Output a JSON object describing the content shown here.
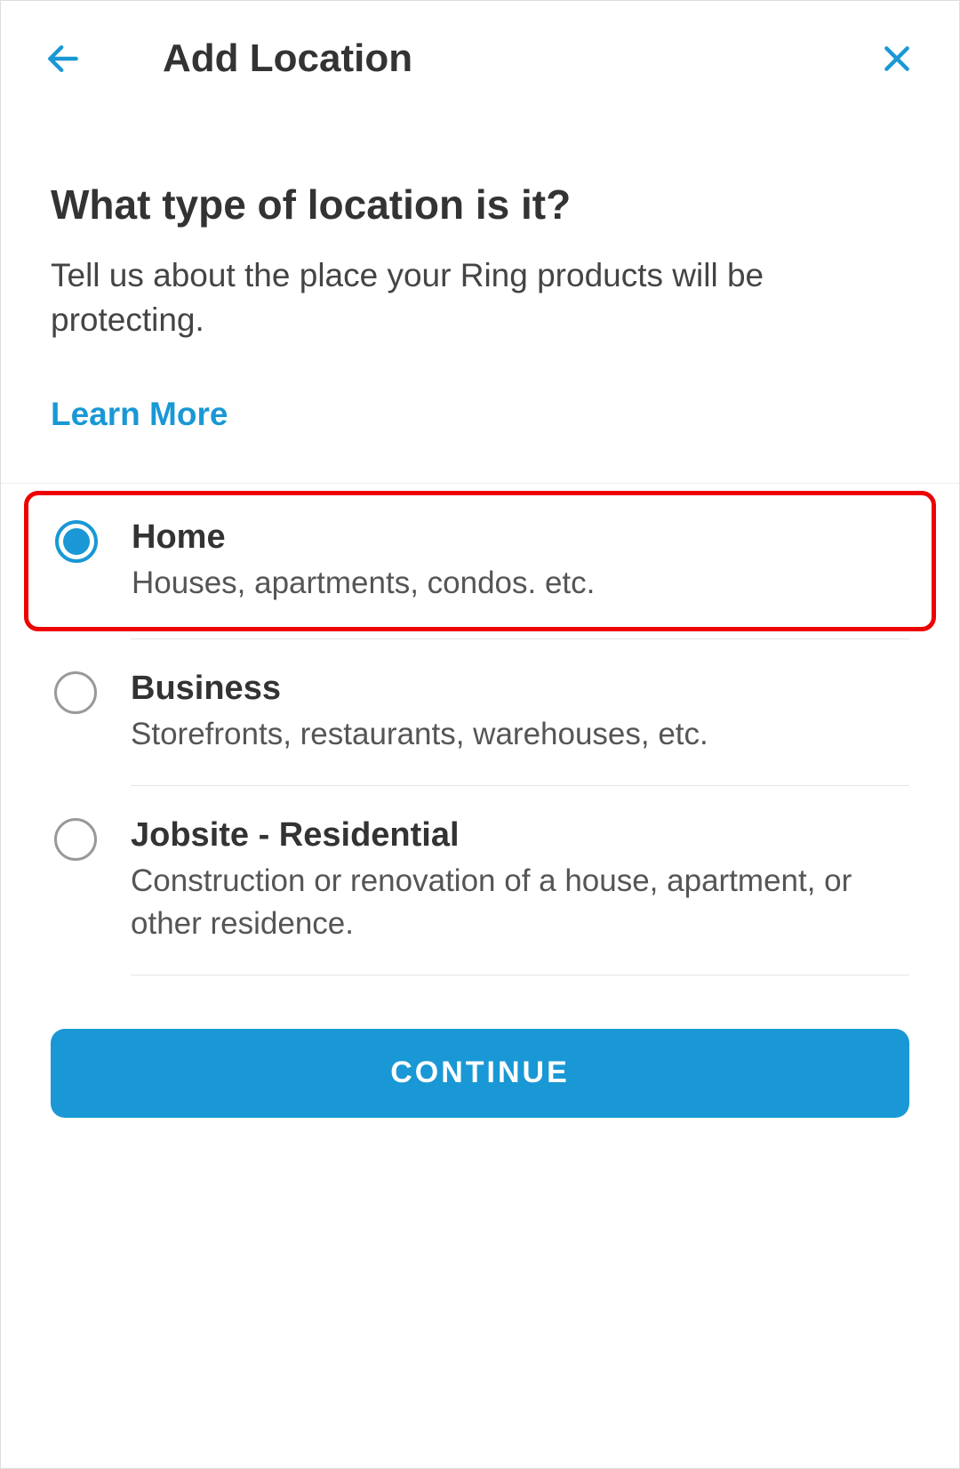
{
  "header": {
    "title": "Add Location"
  },
  "content": {
    "question": "What type of location is it?",
    "subtitle": "Tell us about the place your Ring products will be protecting.",
    "learn_more_label": "Learn More"
  },
  "options": [
    {
      "title": "Home",
      "description": "Houses, apartments, condos. etc.",
      "selected": true,
      "highlighted": true
    },
    {
      "title": "Business",
      "description": "Storefronts, restaurants, warehouses, etc.",
      "selected": false,
      "highlighted": false
    },
    {
      "title": "Jobsite - Residential",
      "description": "Construction or renovation of a house, apartment, or other residence.",
      "selected": false,
      "highlighted": false
    }
  ],
  "footer": {
    "continue_label": "CONTINUE"
  },
  "colors": {
    "accent": "#1998d5",
    "highlight": "#ed0202"
  }
}
